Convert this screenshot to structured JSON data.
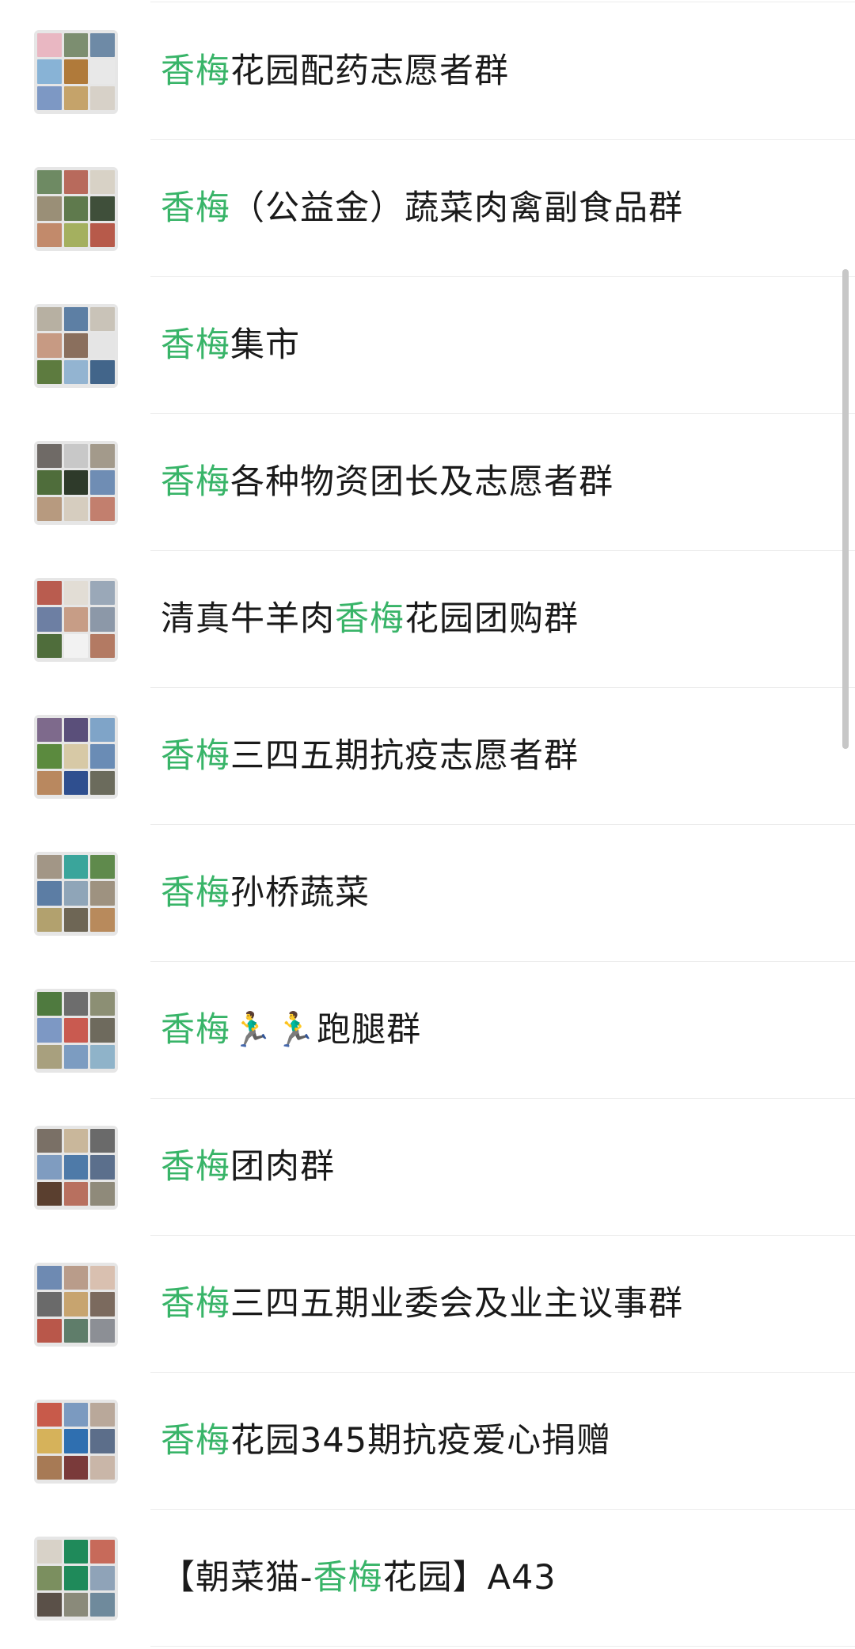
{
  "search_results": [
    {
      "parts": [
        {
          "text": "香梅",
          "highlight": true
        },
        {
          "text": "花园配药志愿者群",
          "highlight": false
        }
      ],
      "avatar_colors": [
        "#e9b7c2",
        "#7c8e70",
        "#6e8aa6",
        "#88b3d6",
        "#b07a3a",
        "#e8e8e8",
        "#7d98c4",
        "#c5a36a",
        "#d7d1c8"
      ]
    },
    {
      "parts": [
        {
          "text": "香梅",
          "highlight": true
        },
        {
          "text": "（公益金）蔬菜肉禽副食品群",
          "highlight": false
        }
      ],
      "avatar_colors": [
        "#6e8a63",
        "#b86a5c",
        "#d8d2c6",
        "#9a8f77",
        "#5f7a4d",
        "#3f4f3a",
        "#c28a6b",
        "#a4b05f",
        "#b75a4a"
      ]
    },
    {
      "parts": [
        {
          "text": "香梅",
          "highlight": true
        },
        {
          "text": "集市",
          "highlight": false
        }
      ],
      "avatar_colors": [
        "#b7b0a2",
        "#5d7fa4",
        "#c9c3b8",
        "#c79a83",
        "#8a6f5d",
        "#e5e5e5",
        "#5d7b3f",
        "#93b4d1",
        "#42658a"
      ]
    },
    {
      "parts": [
        {
          "text": "香梅",
          "highlight": true
        },
        {
          "text": "各种物资团长及志愿者群",
          "highlight": false
        }
      ],
      "avatar_colors": [
        "#6f6a66",
        "#c8c8c8",
        "#a39a8b",
        "#4f6d3b",
        "#2e3a2a",
        "#6f8db4",
        "#b79a7f",
        "#d6cdbf",
        "#c27f6e"
      ]
    },
    {
      "parts": [
        {
          "text": "清真牛羊肉",
          "highlight": false
        },
        {
          "text": "香梅",
          "highlight": true
        },
        {
          "text": "花园团购群",
          "highlight": false
        }
      ],
      "avatar_colors": [
        "#b95c4f",
        "#e2ddd5",
        "#9aa8b8",
        "#6d7fa3",
        "#c79d86",
        "#8c98a8",
        "#4f6d3b",
        "#f2f2f2",
        "#b37a63"
      ]
    },
    {
      "parts": [
        {
          "text": "香梅",
          "highlight": true
        },
        {
          "text": "三四五期抗疫志愿者群",
          "highlight": false
        }
      ],
      "avatar_colors": [
        "#7e6a8c",
        "#5a4f7a",
        "#7fa4c8",
        "#5b8a3e",
        "#d7c9a6",
        "#6a8cb5",
        "#b9885f",
        "#2f4f8f",
        "#6b6b5c"
      ]
    },
    {
      "parts": [
        {
          "text": "香梅",
          "highlight": true
        },
        {
          "text": "孙桥蔬菜",
          "highlight": false
        }
      ],
      "avatar_colors": [
        "#a29686",
        "#3aa59b",
        "#5f8a4c",
        "#5c7da4",
        "#8fa5b8",
        "#9e9280",
        "#b2a16e",
        "#6e6655",
        "#b88a5c"
      ]
    },
    {
      "parts": [
        {
          "text": "香梅",
          "highlight": true
        },
        {
          "text": "🏃‍♂️🏃‍♂️跑腿群",
          "highlight": false
        }
      ],
      "avatar_colors": [
        "#4f7a3f",
        "#6d6d6d",
        "#8c8f74",
        "#7d98c4",
        "#c95a50",
        "#6e6a5d",
        "#a8a07e",
        "#7c9cc1",
        "#8fb3c9"
      ]
    },
    {
      "parts": [
        {
          "text": "香梅",
          "highlight": true
        },
        {
          "text": "团肉群",
          "highlight": false
        }
      ],
      "avatar_colors": [
        "#7a7066",
        "#c9b79b",
        "#6a6a6a",
        "#7f9cc0",
        "#4e7aa8",
        "#5b6f8c",
        "#5a3f2f",
        "#b8705f",
        "#8f8a7a"
      ]
    },
    {
      "parts": [
        {
          "text": "香梅",
          "highlight": true
        },
        {
          "text": "三四五期业委会及业主议事群",
          "highlight": false
        }
      ],
      "avatar_colors": [
        "#6e8ab2",
        "#b99c8a",
        "#d9c0b0",
        "#6a6a6a",
        "#c7a46f",
        "#7b6a5e",
        "#b9574a",
        "#5f7d6a",
        "#8c8f95"
      ]
    },
    {
      "parts": [
        {
          "text": "香梅",
          "highlight": true
        },
        {
          "text": "花园345期抗疫爱心捐赠",
          "highlight": false
        }
      ],
      "avatar_colors": [
        "#c85a4a",
        "#7b9ac0",
        "#b9a89a",
        "#d6b25a",
        "#2f6fb0",
        "#5c6e8a",
        "#a77a55",
        "#7a3a3a",
        "#c9b6a8"
      ]
    },
    {
      "parts": [
        {
          "text": "【朝菜猫-",
          "highlight": false
        },
        {
          "text": "香梅",
          "highlight": true
        },
        {
          "text": "花园】A43",
          "highlight": false
        }
      ],
      "avatar_colors": [
        "#d8d2c8",
        "#1f8a5a",
        "#c76a5a",
        "#7b8f5f",
        "#1f8a5a",
        "#8fa3b8",
        "#5a5048",
        "#8a8a7a",
        "#6f8a9c"
      ]
    }
  ],
  "colors": {
    "highlight": "#38b468",
    "text": "#1a1a1a",
    "divider": "#ececec",
    "scrollbar": "#c7c7c7"
  }
}
